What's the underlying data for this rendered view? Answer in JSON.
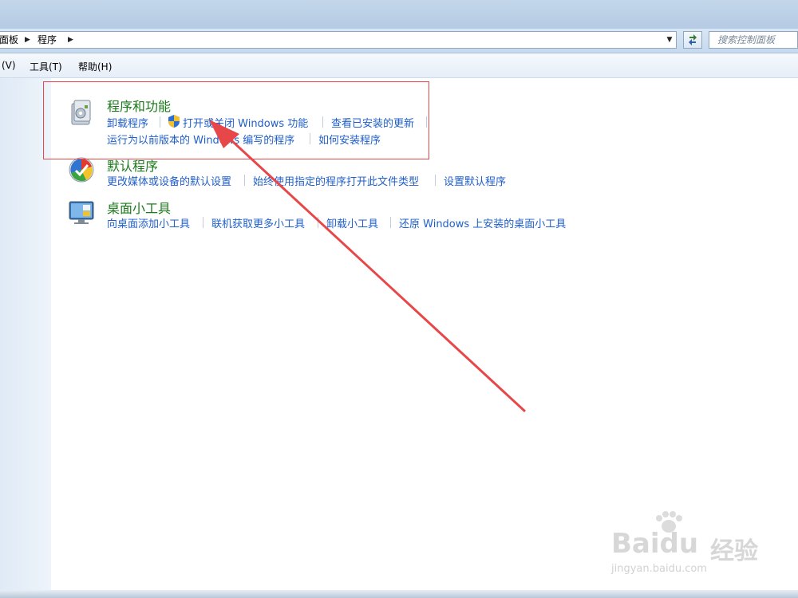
{
  "address_bar": {
    "breadcrumbs": [
      "面板",
      "程序"
    ],
    "search_placeholder": "搜索控制面板"
  },
  "menu": {
    "items": [
      "(V)",
      "工具(T)",
      "帮助(H)"
    ]
  },
  "categories": [
    {
      "title": "程序和功能",
      "icon": "programs-features-icon",
      "links_row1": [
        "卸载程序",
        "打开或关闭 Windows 功能",
        "查看已安装的更新"
      ],
      "links_row2": [
        "运行为以前版本的 Windows 编写的程序",
        "如何安装程序"
      ]
    },
    {
      "title": "默认程序",
      "icon": "default-programs-icon",
      "links_row1": [
        "更改媒体或设备的默认设置",
        "始终使用指定的程序打开此文件类型",
        "设置默认程序"
      ]
    },
    {
      "title": "桌面小工具",
      "icon": "desktop-gadgets-icon",
      "links_row1": [
        "向桌面添加小工具",
        "联机获取更多小工具",
        "卸载小工具",
        "还原 Windows 上安装的桌面小工具"
      ]
    }
  ],
  "watermark": {
    "brand": "Baidu",
    "brand_cn": "经验",
    "url": "jingyan.baidu.com"
  },
  "colors": {
    "category_title": "#1a7a1a",
    "link": "#1f5fc9",
    "annotation": "#e8474a"
  }
}
